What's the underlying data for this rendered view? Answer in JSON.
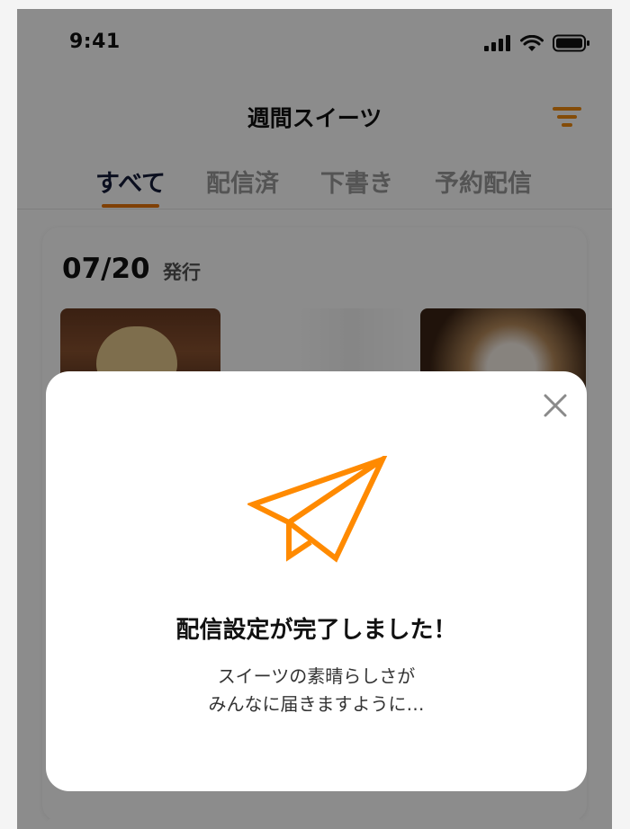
{
  "status_bar": {
    "time": "9:41"
  },
  "header": {
    "title": "週間スイーツ",
    "filter_icon": "filter-icon"
  },
  "tabs": [
    {
      "label": "すべて",
      "active": true
    },
    {
      "label": "配信済",
      "active": false
    },
    {
      "label": "下書き",
      "active": false
    },
    {
      "label": "予約配信",
      "active": false
    }
  ],
  "card": {
    "date": "07/20",
    "issued_label": "発行"
  },
  "modal": {
    "title": "配信設定が完了しました！",
    "message_line1": "スイーツの素晴らしさが",
    "message_line2": "みんなに届きますように…",
    "icon": "paper-plane-icon",
    "close_icon": "close-icon"
  },
  "colors": {
    "accent": "#FF8A00",
    "tab_active": "#141C3A",
    "tab_inactive": "#9A9A9A"
  }
}
